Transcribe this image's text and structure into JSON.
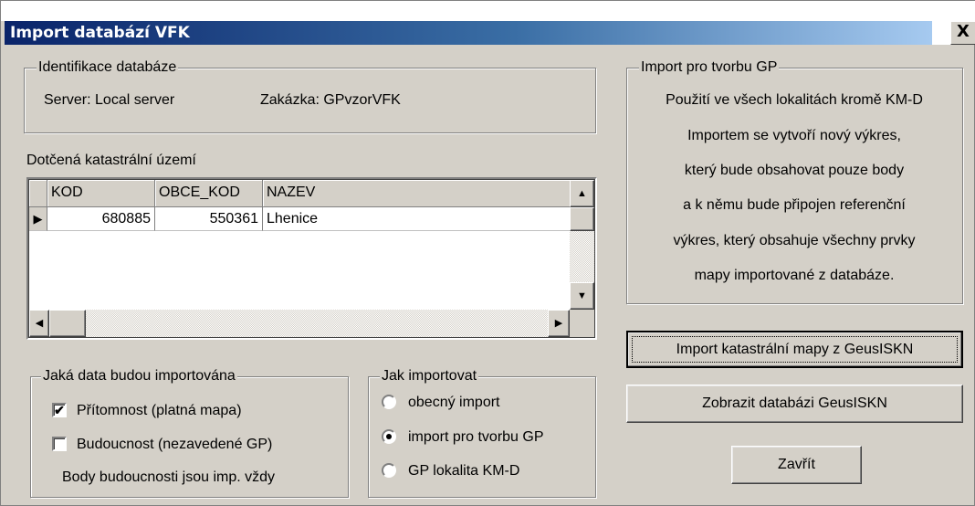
{
  "window": {
    "title": "Import databází VFK",
    "close_glyph": "X"
  },
  "identifikace": {
    "legend": "Identifikace databáze",
    "server": "Server: Local server",
    "zakazka": "Zakázka: GPvzorVFK"
  },
  "grid": {
    "label": "Dotčená katastrální území",
    "columns": [
      "KOD",
      "OBCE_KOD",
      "NAZEV"
    ],
    "rows": [
      {
        "kod": "680885",
        "obce_kod": "550361",
        "nazev": "Lhenice"
      }
    ]
  },
  "data_group": {
    "legend": "Jaká data budou importována",
    "pritomnost": {
      "label": "Přítomnost (platná mapa)",
      "checked": true
    },
    "budoucnost": {
      "label": "Budoucnost (nezavedené GP)",
      "checked": false
    },
    "note": "Body budoucnosti jsou imp. vždy"
  },
  "jak_group": {
    "legend": "Jak importovat",
    "options": [
      {
        "label": "obecný import",
        "selected": false
      },
      {
        "label": "import pro tvorbu GP",
        "selected": true
      },
      {
        "label": "GP lokalita KM-D",
        "selected": false
      }
    ]
  },
  "info_group": {
    "legend": "Import pro tvorbu GP",
    "lines": [
      "Použití ve všech lokalitách kromě KM-D",
      "Importem se vytvoří  nový výkres,",
      "který bude obsahovat pouze body",
      "a k němu bude připojen referenční",
      "výkres, který obsahuje všechny prvky",
      "mapy importované z databáze."
    ]
  },
  "buttons": {
    "import_label": "Import katastrální mapy z GeusISKN",
    "zobrazit_label": "Zobrazit databázi GeusISKN",
    "zavrit_label": "Zavřít"
  },
  "icons": {
    "check": "✔",
    "row_pointer": "▶",
    "arrow_up": "▲",
    "arrow_down": "▼",
    "arrow_left": "◀",
    "arrow_right": "▶"
  }
}
